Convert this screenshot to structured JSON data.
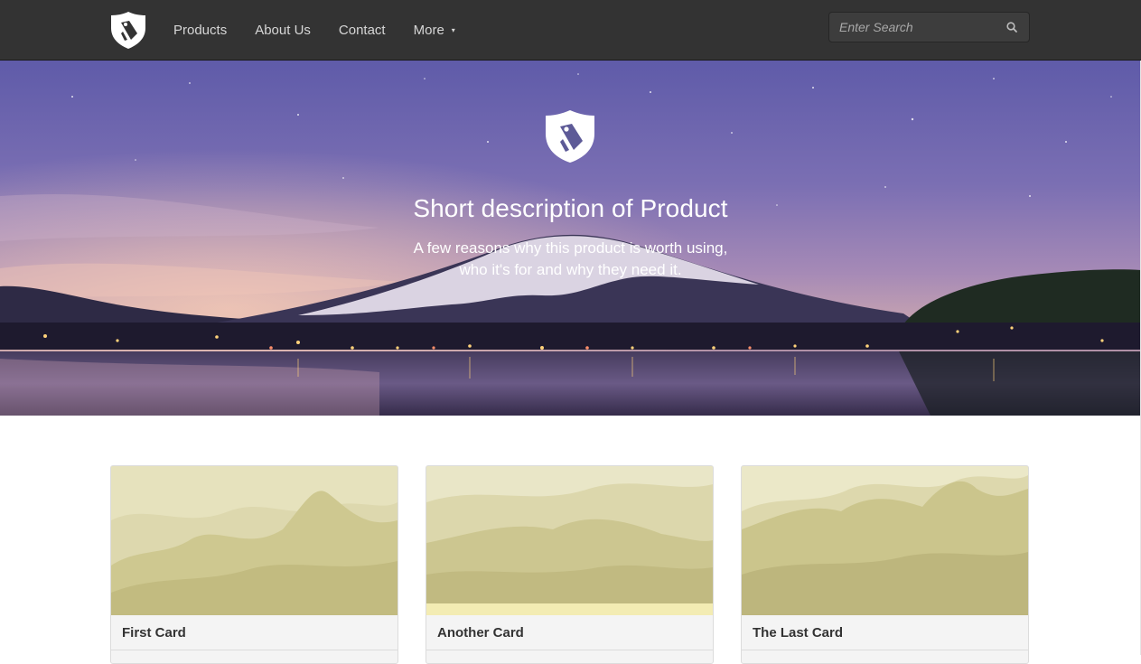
{
  "colors": {
    "navbar_bg": "#333333",
    "nav_text": "#d6d6d6",
    "hero_text": "#ffffff",
    "card_bg": "#f4f4f4",
    "card_image_tint": "#cfc99a",
    "card_title": "#333333"
  },
  "nav": {
    "logo_icon": "shield-tag-icon",
    "links": [
      "Products",
      "About Us",
      "Contact",
      "More"
    ],
    "more_caret": "▾",
    "search": {
      "placeholder": "Enter Search",
      "icon": "search-icon"
    }
  },
  "hero": {
    "logo_icon": "shield-tag-icon",
    "title": "Short description of Product",
    "subtitle_line1": "A few reasons why this product is worth using,",
    "subtitle_line2": "who it's for and why they need it.",
    "background": "night-mountain-lake-photo"
  },
  "cards": [
    {
      "title": "First Card",
      "image": "misty-cliffs-image"
    },
    {
      "title": "Another Card",
      "image": "mountain-range-image"
    },
    {
      "title": "The Last Card",
      "image": "mountain-peaks-image"
    }
  ]
}
